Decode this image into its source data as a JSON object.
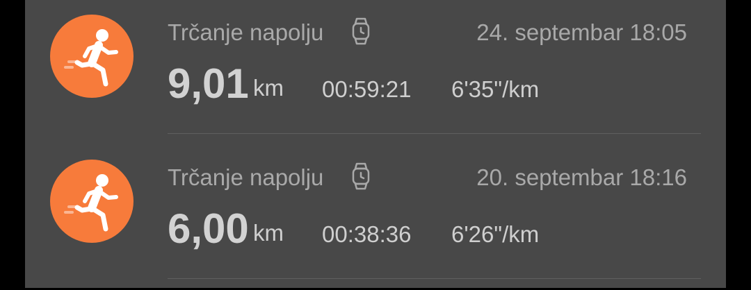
{
  "activities": [
    {
      "type": "Trčanje napolju",
      "date": "24. septembar 18:05",
      "distance": "9,01",
      "unit": "km",
      "duration": "00:59:21",
      "pace": "6'35\"/km",
      "icon": "running-person-icon",
      "device_icon": "watch-icon",
      "accent_color": "#f77b3b"
    },
    {
      "type": "Trčanje napolju",
      "date": "20. septembar 18:16",
      "distance": "6,00",
      "unit": "km",
      "duration": "00:38:36",
      "pace": "6'26\"/km",
      "icon": "running-person-icon",
      "device_icon": "watch-icon",
      "accent_color": "#f77b3b"
    }
  ]
}
